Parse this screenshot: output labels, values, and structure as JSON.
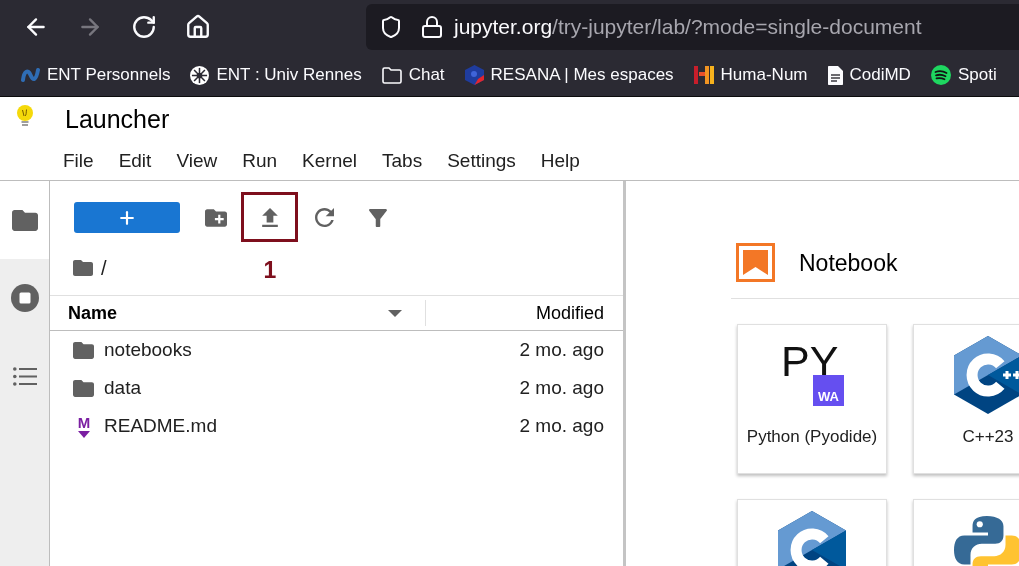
{
  "browser": {
    "nav_buttons": [
      {
        "kind": "back",
        "disabled": false
      },
      {
        "kind": "forward",
        "disabled": true
      },
      {
        "kind": "reload",
        "disabled": false
      },
      {
        "kind": "home",
        "disabled": false
      }
    ],
    "address": {
      "host": "jupyter.org",
      "path": "/try-jupyter/lab/?mode=single-document"
    },
    "bookmarks": [
      {
        "kind": "wave",
        "label": "ENT Personnels"
      },
      {
        "kind": "wheel",
        "label": "ENT : Univ Rennes"
      },
      {
        "kind": "folder",
        "label": "Chat"
      },
      {
        "kind": "shield",
        "label": "RESANA | Mes espaces"
      },
      {
        "kind": "bars",
        "label": "Huma-Num"
      },
      {
        "kind": "document",
        "label": "CodiMD"
      },
      {
        "kind": "disc",
        "label": "Spoti"
      }
    ]
  },
  "app": {
    "title": "Launcher",
    "menu": [
      "File",
      "Edit",
      "View",
      "Run",
      "Kernel",
      "Tabs",
      "Settings",
      "Help"
    ]
  },
  "sidebar": {
    "tabs": [
      {
        "kind": "files",
        "selected": true
      },
      {
        "kind": "running",
        "selected": false
      },
      {
        "kind": "toc",
        "selected": false
      }
    ]
  },
  "file_browser": {
    "toolbar": [
      {
        "kind": "new",
        "highlighted": false
      },
      {
        "kind": "new_folder",
        "highlighted": false
      },
      {
        "kind": "upload",
        "highlighted": true,
        "annotation": "1"
      },
      {
        "kind": "refresh",
        "highlighted": false
      },
      {
        "kind": "filter",
        "highlighted": false
      }
    ],
    "breadcrumb": "/",
    "columns": [
      {
        "label": "Name",
        "sorted": true
      },
      {
        "label": "Modified",
        "sorted": false
      }
    ],
    "files": [
      {
        "kind": "folder",
        "name": "notebooks",
        "modified": "2 mo. ago"
      },
      {
        "kind": "folder",
        "name": "data",
        "modified": "2 mo. ago"
      },
      {
        "kind": "markdown",
        "icon_text": "M",
        "name": "README.md",
        "modified": "2 mo. ago"
      }
    ]
  },
  "launcher": {
    "section": {
      "kind": "notebook",
      "title": "Notebook"
    },
    "cards": [
      {
        "kind": "pyodide",
        "logo_text": [
          "PY",
          "WA"
        ],
        "label": "Python (Pyodide)"
      },
      {
        "kind": "cpp",
        "label": "C++23"
      },
      {
        "kind": "c"
      },
      {
        "kind": "python"
      }
    ]
  }
}
